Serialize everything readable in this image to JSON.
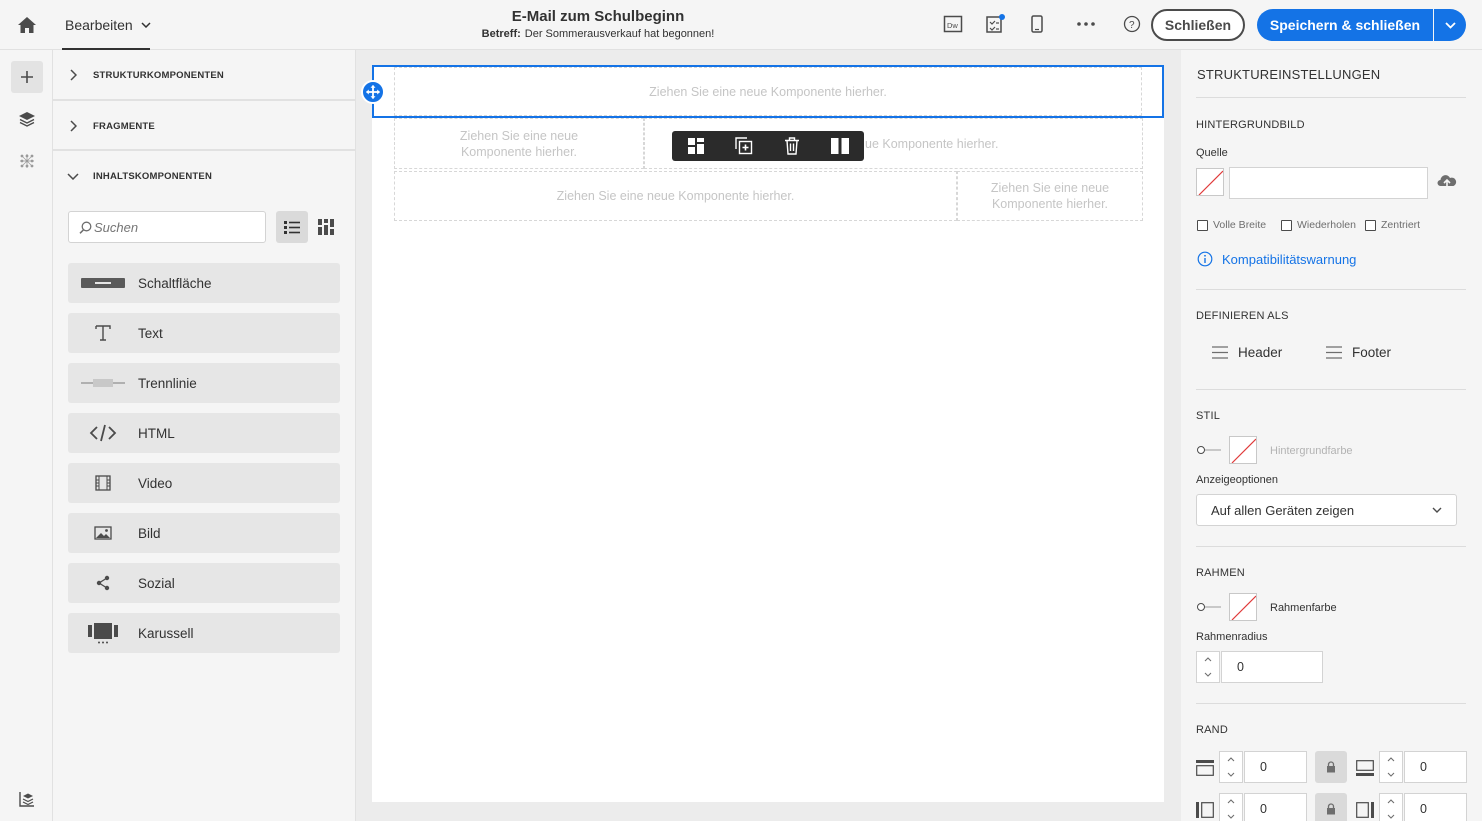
{
  "topbar": {
    "mode_label": "Bearbeiten",
    "email_title": "E-Mail zum Schulbeginn",
    "subject_label": "Betreff:",
    "subject_value": "Der Sommerausverkauf hat begonnen!",
    "close_label": "Schließen",
    "save_label": "Speichern & schließen",
    "icons": [
      "home-icon",
      "dreamweaver-icon",
      "checklist-icon",
      "mobile-preview-icon",
      "more-icon",
      "help-icon",
      "chevron-down-icon"
    ]
  },
  "panel": {
    "sections": [
      {
        "label": "STRUKTURKOMPONENTEN",
        "expanded": false
      },
      {
        "label": "FRAGMENTE",
        "expanded": false
      },
      {
        "label": "INHALTSKOMPONENTEN",
        "expanded": true
      }
    ],
    "search_placeholder": "Suchen",
    "components": [
      {
        "label": "Schaltfläche",
        "icon": "button-icon"
      },
      {
        "label": "Text",
        "icon": "text-icon"
      },
      {
        "label": "Trennlinie",
        "icon": "divider-icon"
      },
      {
        "label": "HTML",
        "icon": "code-icon"
      },
      {
        "label": "Video",
        "icon": "film-icon"
      },
      {
        "label": "Bild",
        "icon": "image-icon"
      },
      {
        "label": "Sozial",
        "icon": "share-icon"
      },
      {
        "label": "Karussell",
        "icon": "carousel-icon"
      }
    ]
  },
  "canvas": {
    "drop_text": "Ziehen Sie eine neue Komponente hierher.",
    "drop_text_split_1": "Ziehen Sie eine neue",
    "drop_text_split_2": "Komponente hierher.",
    "drop_text_partial": "ue Komponente hierher."
  },
  "settings": {
    "title": "STRUKTUREINSTELLUNGEN",
    "bg_image_head": "HINTERGRUNDBILD",
    "source_label": "Quelle",
    "source_value": "",
    "checkboxes": [
      "Volle Breite",
      "Wiederholen",
      "Zentriert"
    ],
    "compat_warning": "Kompatibilitätswarnung",
    "define_as_head": "DEFINIEREN ALS",
    "header_label": "Header",
    "footer_label": "Footer",
    "style_head": "STIL",
    "bg_color_label": "Hintergrundfarbe",
    "display_options_label": "Anzeigeoptionen",
    "display_option_selected": "Auf allen Geräten zeigen",
    "border_head": "RAHMEN",
    "border_color_label": "Rahmenfarbe",
    "border_radius_label": "Rahmenradius",
    "border_radius_value": "0",
    "margin_head": "RAND",
    "margin_values": [
      "0",
      "0",
      "0",
      "0"
    ]
  },
  "colors": {
    "accent": "#1473e6",
    "toolbar": "#2b2b2b",
    "text": "#323232"
  }
}
